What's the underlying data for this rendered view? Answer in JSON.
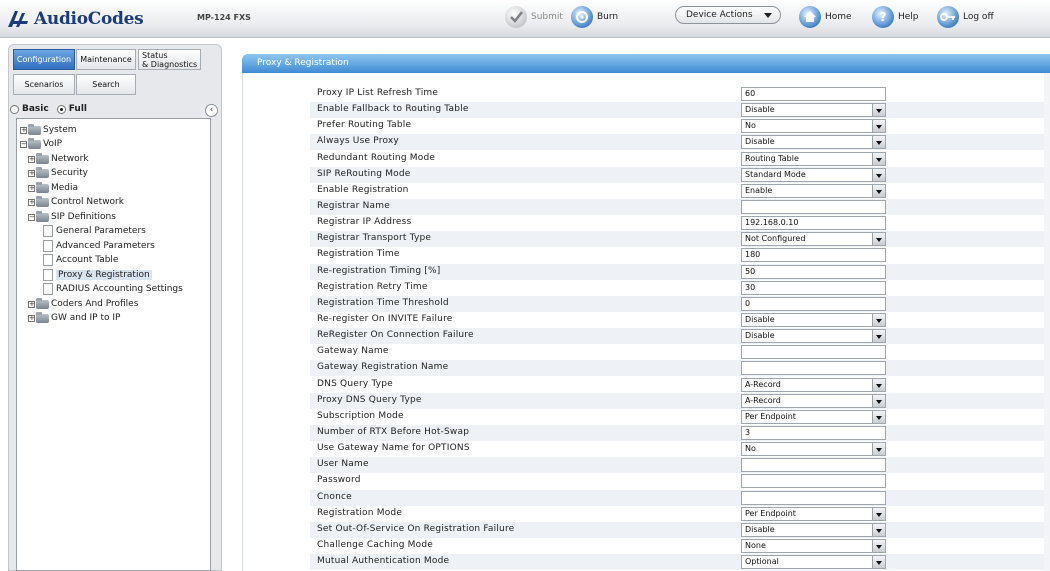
{
  "brand": {
    "name": "AudioCodes",
    "product": "MP-124 FXS"
  },
  "toolbar": {
    "submit": "Submit",
    "burn": "Burn",
    "device_actions": "Device Actions",
    "home": "Home",
    "help": "Help",
    "logoff": "Log off"
  },
  "tabs": {
    "configuration": "Configuration",
    "maintenance": "Maintenance",
    "status_line1": "Status",
    "status_line2": "& Diagnostics",
    "scenarios": "Scenarios",
    "search": "Search"
  },
  "mode": {
    "basic": "Basic",
    "full": "Full",
    "selected": "Full"
  },
  "tree": {
    "system": "System",
    "voip": "VoIP",
    "network": "Network",
    "security": "Security",
    "media": "Media",
    "control_network": "Control Network",
    "sip_definitions": "SIP Definitions",
    "general_parameters": "General Parameters",
    "advanced_parameters": "Advanced Parameters",
    "account_table": "Account Table",
    "proxy_registration": "Proxy & Registration",
    "radius_accounting": "RADIUS Accounting Settings",
    "coders_profiles": "Coders And Profiles",
    "gw_ip_to_ip": "GW and IP to IP"
  },
  "page": {
    "title": "Proxy & Registration"
  },
  "rows": [
    {
      "label": "Proxy IP List Refresh Time",
      "value": "60",
      "type": "text"
    },
    {
      "label": "Enable Fallback to Routing Table",
      "value": "Disable",
      "type": "select"
    },
    {
      "label": "Prefer Routing Table",
      "value": "No",
      "type": "select"
    },
    {
      "label": "Always Use Proxy",
      "value": "Disable",
      "type": "select"
    },
    {
      "label": "Redundant Routing Mode",
      "value": "Routing Table",
      "type": "select"
    },
    {
      "label": "SIP ReRouting Mode",
      "value": "Standard Mode",
      "type": "select"
    },
    {
      "label": "Enable Registration",
      "value": "Enable",
      "type": "select"
    },
    {
      "label": "Registrar Name",
      "value": "",
      "type": "text"
    },
    {
      "label": "Registrar IP Address",
      "value": "192.168.0.10",
      "type": "text"
    },
    {
      "label": "Registrar Transport Type",
      "value": "Not Configured",
      "type": "select"
    },
    {
      "label": "Registration Time",
      "value": "180",
      "type": "text"
    },
    {
      "label": "Re-registration Timing [%]",
      "value": "50",
      "type": "text"
    },
    {
      "label": "Registration Retry Time",
      "value": "30",
      "type": "text"
    },
    {
      "label": "Registration Time Threshold",
      "value": "0",
      "type": "text"
    },
    {
      "label": "Re-register On INVITE Failure",
      "value": "Disable",
      "type": "select"
    },
    {
      "label": "ReRegister On Connection Failure",
      "value": "Disable",
      "type": "select"
    },
    {
      "label": "Gateway Name",
      "value": "",
      "type": "text"
    },
    {
      "label": "Gateway Registration Name",
      "value": "",
      "type": "text"
    },
    {
      "label": "DNS Query Type",
      "value": "A-Record",
      "type": "select"
    },
    {
      "label": "Proxy DNS Query Type",
      "value": "A-Record",
      "type": "select"
    },
    {
      "label": "Subscription Mode",
      "value": "Per Endpoint",
      "type": "select"
    },
    {
      "label": "Number of RTX Before Hot-Swap",
      "value": "3",
      "type": "text"
    },
    {
      "label": "Use Gateway Name for OPTIONS",
      "value": "No",
      "type": "select"
    },
    {
      "label": "User Name",
      "value": "",
      "type": "text"
    },
    {
      "label": "Password",
      "value": "",
      "type": "text"
    },
    {
      "label": "Cnonce",
      "value": "",
      "type": "text"
    },
    {
      "label": "Registration Mode",
      "value": "Per Endpoint",
      "type": "select"
    },
    {
      "label": "Set Out-Of-Service On Registration Failure",
      "value": "Disable",
      "type": "select"
    },
    {
      "label": "Challenge Caching Mode",
      "value": "None",
      "type": "select"
    },
    {
      "label": "Mutual Authentication Mode",
      "value": "Optional",
      "type": "select"
    }
  ]
}
